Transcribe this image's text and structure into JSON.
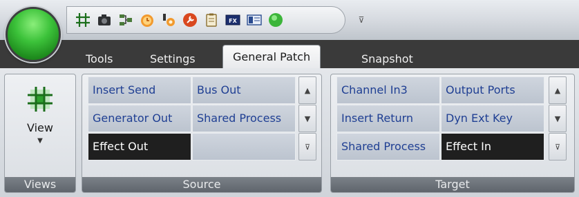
{
  "app": {
    "orb_color": "#3cc23a"
  },
  "quick_access": {
    "icons": [
      "grid-icon",
      "camera-icon",
      "routing-icon",
      "clock-icon",
      "settings-gear-icon",
      "wrench-circle-icon",
      "clipboard-icon",
      "fx-icon",
      "panel-icon",
      "green-circle-icon"
    ],
    "overflow_icon": "overflow-dropdown-icon"
  },
  "tabs": [
    {
      "label": "Tools",
      "active": false
    },
    {
      "label": "Settings",
      "active": false
    },
    {
      "label": "General Patch",
      "active": true
    },
    {
      "label": "Snapshot",
      "active": false
    }
  ],
  "groups": {
    "views": {
      "label": "Views",
      "view_button_label": "View"
    },
    "source": {
      "label": "Source",
      "cells": [
        [
          "Insert Send",
          "Bus Out"
        ],
        [
          "Generator Out",
          "Shared Process"
        ],
        [
          "Effect Out",
          ""
        ]
      ],
      "selected": "Effect Out"
    },
    "target": {
      "label": "Target",
      "cells": [
        [
          "Channel In3",
          "Output Ports"
        ],
        [
          "Insert Return",
          "Dyn Ext Key"
        ],
        [
          "Shared Process",
          "Effect In"
        ]
      ],
      "selected": "Effect In"
    }
  },
  "colors": {
    "cell_text": "#1f3f93",
    "selected_bg": "#1f1f1f",
    "tabstrip_bg": "#3a3a3a"
  }
}
